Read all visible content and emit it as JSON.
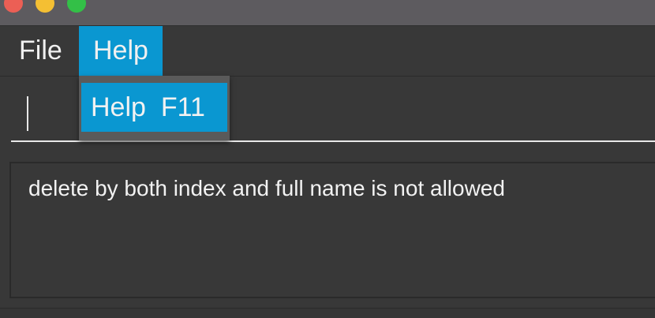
{
  "window": {
    "controls": [
      "close-dot",
      "minimize-dot",
      "maximize-dot"
    ]
  },
  "menubar": {
    "items": [
      {
        "label": "File"
      },
      {
        "label": "Help",
        "selected": true
      }
    ]
  },
  "help_menu": {
    "items": [
      {
        "label": "Help",
        "shortcut": "F11"
      }
    ]
  },
  "command_box": {
    "value": ""
  },
  "result_display": {
    "text": "delete by both index and full name is not allowed"
  },
  "colors": {
    "accent": "#0a97d1",
    "background": "#383838",
    "titlebar": "#5d5b5f",
    "text": "#f2f2f2"
  }
}
